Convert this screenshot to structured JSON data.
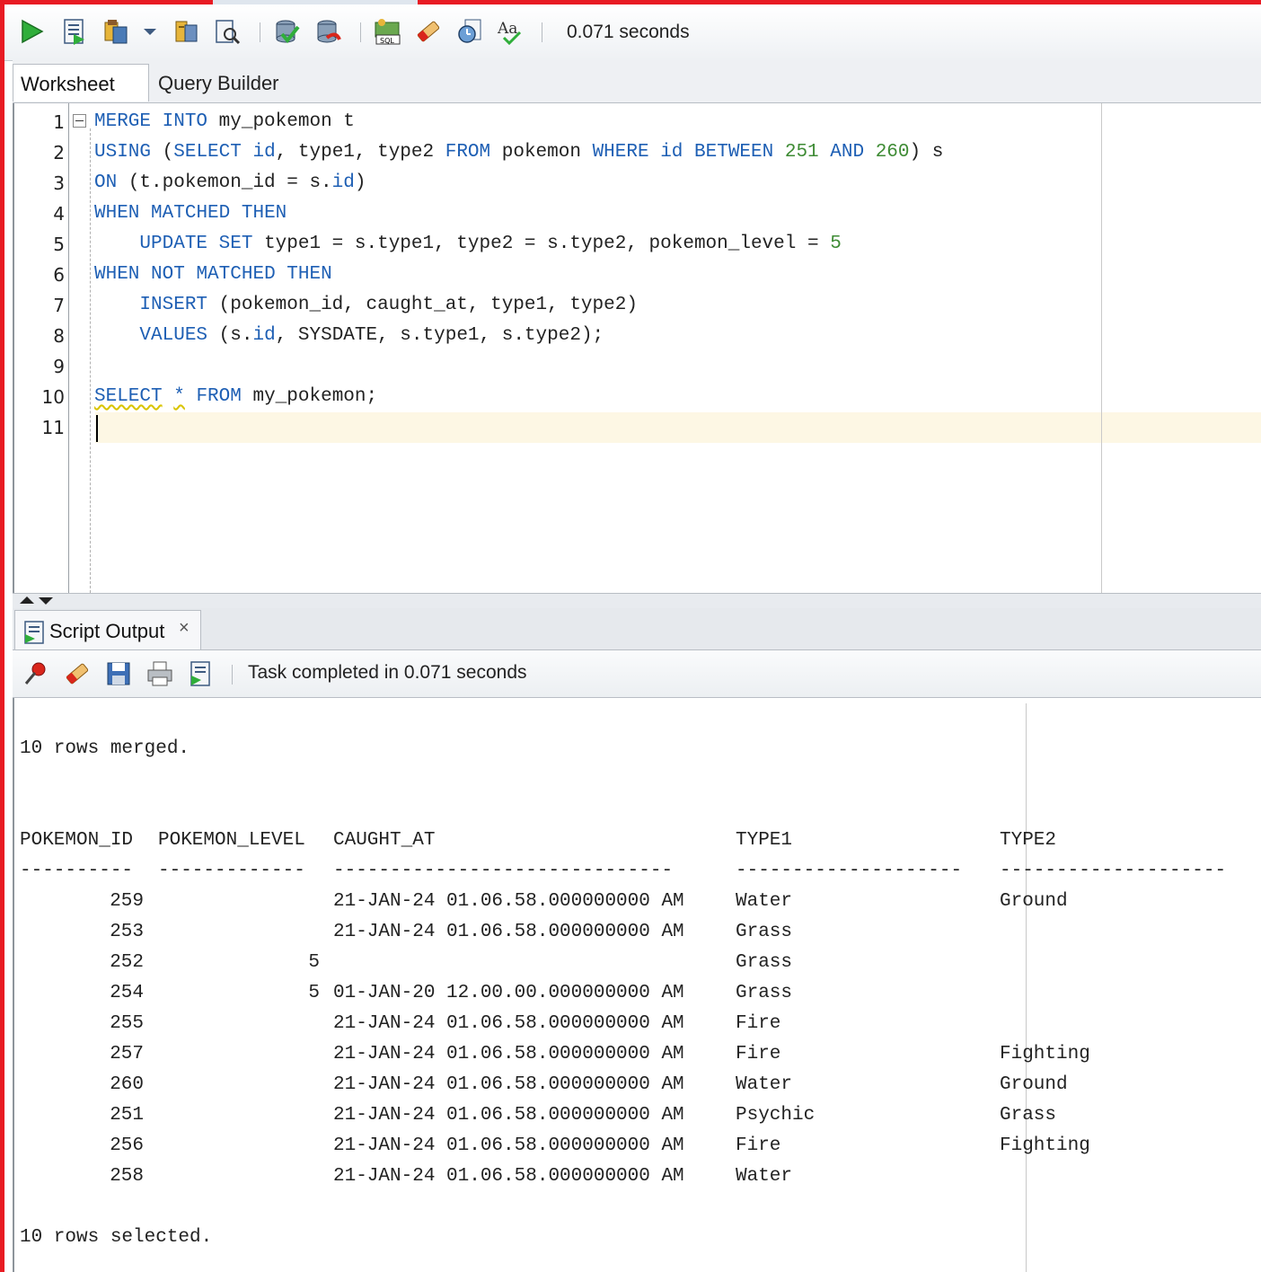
{
  "toolbar": {
    "buttons": [
      {
        "name": "run-statement-icon"
      },
      {
        "name": "run-script-icon"
      },
      {
        "name": "autotrace-icon"
      },
      {
        "name": "dropdown-arrow-icon"
      },
      {
        "name": "explain-plan-icon"
      },
      {
        "name": "sql-tuning-advisor-icon"
      },
      {
        "name": "commit-icon"
      },
      {
        "name": "rollback-icon"
      },
      {
        "name": "unshared-sql-icon"
      },
      {
        "name": "clear-icon"
      },
      {
        "name": "sql-history-icon"
      },
      {
        "name": "format-sql-icon"
      }
    ],
    "status": "0.071 seconds"
  },
  "editor_tabs": [
    {
      "label": "Worksheet",
      "active": true
    },
    {
      "label": "Query Builder",
      "active": false
    }
  ],
  "editor": {
    "line_numbers": [
      "1",
      "2",
      "3",
      "4",
      "5",
      "6",
      "7",
      "8",
      "9",
      "10",
      "11"
    ],
    "lines": [
      [
        {
          "t": "MERGE",
          "k": "kw"
        },
        {
          "t": " "
        },
        {
          "t": "INTO",
          "k": "kw"
        },
        {
          "t": " my_pokemon t"
        }
      ],
      [
        {
          "t": "USING",
          "k": "kw"
        },
        {
          "t": " ("
        },
        {
          "t": "SELECT",
          "k": "kw"
        },
        {
          "t": " "
        },
        {
          "t": "id",
          "k": "kw"
        },
        {
          "t": ", type1, type2 "
        },
        {
          "t": "FROM",
          "k": "kw"
        },
        {
          "t": " pokemon "
        },
        {
          "t": "WHERE",
          "k": "kw"
        },
        {
          "t": " "
        },
        {
          "t": "id",
          "k": "kw"
        },
        {
          "t": " "
        },
        {
          "t": "BETWEEN",
          "k": "kw"
        },
        {
          "t": " "
        },
        {
          "t": "251",
          "k": "num"
        },
        {
          "t": " "
        },
        {
          "t": "AND",
          "k": "kw"
        },
        {
          "t": " "
        },
        {
          "t": "260",
          "k": "num"
        },
        {
          "t": ") s"
        }
      ],
      [
        {
          "t": "ON",
          "k": "kw"
        },
        {
          "t": " (t.pokemon_id = s."
        },
        {
          "t": "id",
          "k": "kw"
        },
        {
          "t": ")"
        }
      ],
      [
        {
          "t": "WHEN",
          "k": "kw"
        },
        {
          "t": " "
        },
        {
          "t": "MATCHED",
          "k": "kw"
        },
        {
          "t": " "
        },
        {
          "t": "THEN",
          "k": "kw"
        }
      ],
      [
        {
          "t": "    "
        },
        {
          "t": "UPDATE",
          "k": "kw"
        },
        {
          "t": " "
        },
        {
          "t": "SET",
          "k": "kw"
        },
        {
          "t": " type1 = s.type1, type2 = s.type2, pokemon_level = "
        },
        {
          "t": "5",
          "k": "num"
        }
      ],
      [
        {
          "t": "WHEN",
          "k": "kw"
        },
        {
          "t": " "
        },
        {
          "t": "NOT",
          "k": "kw"
        },
        {
          "t": " "
        },
        {
          "t": "MATCHED",
          "k": "kw"
        },
        {
          "t": " "
        },
        {
          "t": "THEN",
          "k": "kw"
        }
      ],
      [
        {
          "t": "    "
        },
        {
          "t": "INSERT",
          "k": "kw"
        },
        {
          "t": " (pokemon_id, caught_at, type1, type2)"
        }
      ],
      [
        {
          "t": "    "
        },
        {
          "t": "VALUES",
          "k": "kw"
        },
        {
          "t": " (s."
        },
        {
          "t": "id",
          "k": "kw"
        },
        {
          "t": ", SYSDATE, s.type1, s.type2);"
        }
      ],
      [],
      [
        {
          "t": "SELECT",
          "k": "kw sq"
        },
        {
          "t": " "
        },
        {
          "t": "*",
          "k": "kw sq"
        },
        {
          "t": " "
        },
        {
          "t": "FROM",
          "k": "kw"
        },
        {
          "t": " my_pokemon;"
        }
      ],
      []
    ]
  },
  "output_panel": {
    "tab_label": "Script Output",
    "tab_close": "×",
    "toolbar_buttons": [
      {
        "name": "pin-icon"
      },
      {
        "name": "clear-output-icon"
      },
      {
        "name": "save-icon"
      },
      {
        "name": "print-icon"
      },
      {
        "name": "script-icon"
      }
    ],
    "status": "Task completed in 0.071 seconds",
    "merge_message": "10 rows merged.",
    "columns": [
      "POKEMON_ID",
      "POKEMON_LEVEL",
      "CAUGHT_AT",
      "TYPE1",
      "TYPE2"
    ],
    "underlines": [
      "----------",
      "-------------",
      "------------------------------",
      "--------------------",
      "--------------------"
    ],
    "rows": [
      [
        "259",
        "",
        "21-JAN-24 01.06.58.000000000 AM",
        "Water",
        "Ground"
      ],
      [
        "253",
        "",
        "21-JAN-24 01.06.58.000000000 AM",
        "Grass",
        ""
      ],
      [
        "252",
        "5",
        "",
        "Grass",
        ""
      ],
      [
        "254",
        "5",
        "01-JAN-20 12.00.00.000000000 AM",
        "Grass",
        ""
      ],
      [
        "255",
        "",
        "21-JAN-24 01.06.58.000000000 AM",
        "Fire",
        ""
      ],
      [
        "257",
        "",
        "21-JAN-24 01.06.58.000000000 AM",
        "Fire",
        "Fighting"
      ],
      [
        "260",
        "",
        "21-JAN-24 01.06.58.000000000 AM",
        "Water",
        "Ground"
      ],
      [
        "251",
        "",
        "21-JAN-24 01.06.58.000000000 AM",
        "Psychic",
        "Grass"
      ],
      [
        "256",
        "",
        "21-JAN-24 01.06.58.000000000 AM",
        "Fire",
        "Fighting"
      ],
      [
        "258",
        "",
        "21-JAN-24 01.06.58.000000000 AM",
        "Water",
        ""
      ]
    ],
    "select_message": "10 rows selected."
  }
}
